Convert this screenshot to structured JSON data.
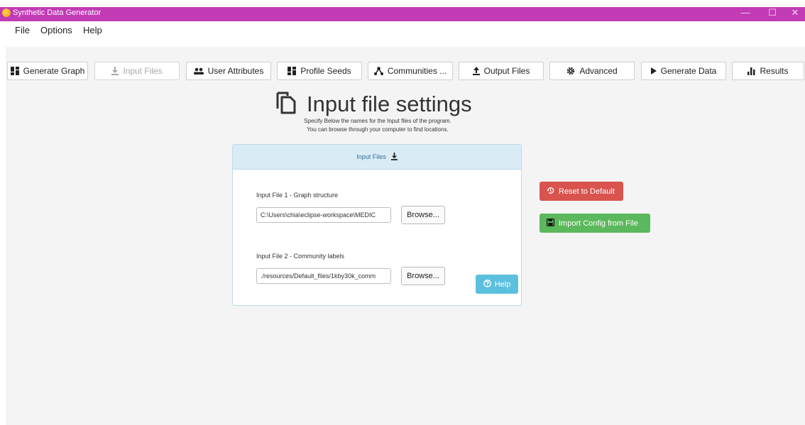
{
  "window": {
    "title": "Synthetic Data Generator",
    "controls": {
      "minimize": "—",
      "maximize": "☐",
      "close": "✕"
    }
  },
  "menu": [
    "File",
    "Options",
    "Help"
  ],
  "tabs": [
    {
      "label": "Generate Graph",
      "icon": "dashboard-icon"
    },
    {
      "label": "Input Files",
      "icon": "download-icon",
      "disabled": true
    },
    {
      "label": "User Attributes",
      "icon": "users-icon"
    },
    {
      "label": "Profile Seeds",
      "icon": "grid-icon"
    },
    {
      "label": "Communities ...",
      "icon": "hierarchy-icon"
    },
    {
      "label": "Output Files",
      "icon": "upload-icon"
    },
    {
      "label": "Advanced",
      "icon": "gear-icon"
    },
    {
      "label": "Generate Data",
      "icon": "play-icon"
    },
    {
      "label": "Results",
      "icon": "bar-chart-icon"
    }
  ],
  "heading": {
    "title": "Input file settings",
    "subtitle_line1": "Specify Below the names for the Input files of the program.",
    "subtitle_line2": "You can browse through your computer to find locations."
  },
  "panel": {
    "header": "Input Files",
    "file1_label": "Input File 1 - Graph structure",
    "file1_value": "C:\\Users\\chia\\eclipse-workspace\\MEDIC",
    "file2_label": "Input File 2 - Community labels",
    "file2_value": "./resources/Default_files/1kby30k_comm",
    "browse_label": "Browse...",
    "help_label": "Help"
  },
  "actions": {
    "reset_label": "Reset to Default",
    "import_label": "Import Config from File"
  },
  "colors": {
    "titlebar": "#c13bb5",
    "panel_header": "#d9ebf5",
    "help": "#5bc0de",
    "reset": "#d9534f",
    "import": "#5cb85c"
  }
}
